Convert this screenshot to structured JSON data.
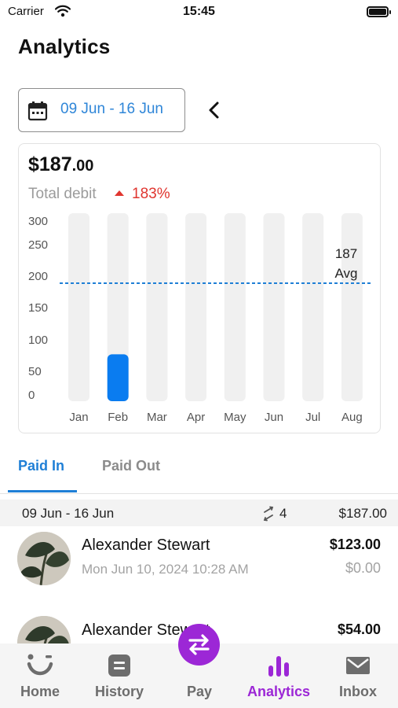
{
  "status_bar": {
    "carrier": "Carrier",
    "time": "15:45"
  },
  "page": {
    "title": "Analytics"
  },
  "date_picker": {
    "range": "09 Jun - 16 Jun"
  },
  "summary": {
    "amount_main": "$187",
    "amount_cents": ".00",
    "label": "Total debit",
    "change": "183%",
    "accent_color": "#1f7fd6",
    "negative_color": "#e0352f"
  },
  "chart_data": {
    "type": "bar",
    "categories": [
      "Jan",
      "Feb",
      "Mar",
      "Apr",
      "May",
      "Jun",
      "Jul",
      "Aug"
    ],
    "values": [
      0,
      87,
      0,
      0,
      0,
      0,
      0,
      0
    ],
    "y_ticks": [
      "300",
      "250",
      "200",
      "150",
      "100",
      "50",
      "0"
    ],
    "avg_value": 187,
    "avg_labels": [
      "187",
      "Avg"
    ],
    "bar_color": "#0a7cf0",
    "track_color": "#f0f0f0",
    "avg_line_color": "#1f7fd6"
  },
  "tabs": {
    "paid_in": "Paid In",
    "paid_out": "Paid Out",
    "active": "paid_in"
  },
  "section": {
    "range": "09 Jun - 16 Jun",
    "count": "4",
    "total": "$187.00"
  },
  "transactions": [
    {
      "name": "Alexander Stewart",
      "date": "Mon Jun 10, 2024 10:28 AM",
      "amount": "$123.00",
      "sub_amount": "$0.00"
    },
    {
      "name": "Alexander Stewart",
      "amount": "$54.00"
    }
  ],
  "nav": {
    "items": [
      {
        "label": "Home",
        "icon": "smile-icon"
      },
      {
        "label": "History",
        "icon": "history-icon"
      },
      {
        "label": "Pay",
        "icon": "transfer-icon"
      },
      {
        "label": "Analytics",
        "icon": "bar-chart-icon"
      },
      {
        "label": "Inbox",
        "icon": "mail-icon"
      }
    ],
    "active": "Analytics",
    "active_color": "#9c27d6"
  }
}
